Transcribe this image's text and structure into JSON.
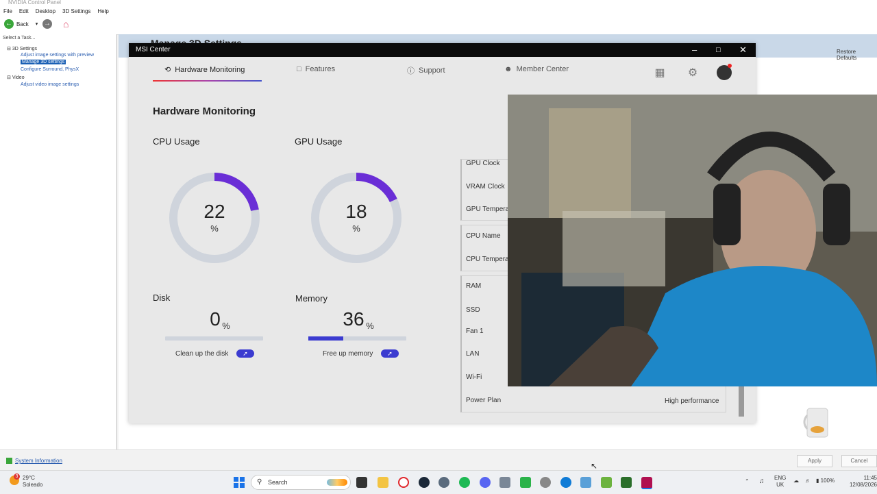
{
  "nvidia": {
    "title": "NVIDIA Control Panel",
    "menu": [
      "File",
      "Edit",
      "Desktop",
      "3D Settings",
      "Help"
    ],
    "back_label": "Back",
    "select_task": "Select a Task...",
    "tree": {
      "group_3d": "3D Settings",
      "adjust_preview": "Adjust image settings with preview",
      "manage_3d": "Manage 3D settings",
      "surround": "Configure Surround, PhysX",
      "group_video": "Video",
      "adjust_video": "Adjust video image settings"
    },
    "page_title": "Manage 3D Settings",
    "restore_defaults": "Restore Defaults",
    "system_information": "System Information",
    "apply": "Apply",
    "cancel": "Cancel"
  },
  "msi": {
    "window_title": "MSI Center",
    "nav": {
      "hardware_monitoring": "Hardware Monitoring",
      "features": "Features",
      "support": "Support",
      "member_center": "Member Center"
    },
    "section_title": "Hardware Monitoring",
    "cpu": {
      "label": "CPU Usage",
      "value": "22",
      "unit": "%",
      "fraction": 0.22
    },
    "gpu": {
      "label": "GPU Usage",
      "value": "18",
      "unit": "%",
      "fraction": 0.18
    },
    "disk": {
      "label": "Disk",
      "value": "0",
      "unit": "%",
      "fraction": 0.0,
      "action": "Clean up the disk"
    },
    "memory": {
      "label": "Memory",
      "value": "36",
      "unit": "%",
      "fraction": 0.36,
      "action": "Free up memory"
    },
    "info_rows": {
      "gpu_clock": "GPU Clock",
      "vram_clock": "VRAM Clock",
      "gpu_temp": "GPU Tempera",
      "cpu_name": "CPU Name",
      "cpu_temp": "CPU Tempera",
      "ram": "RAM",
      "ssd": "SSD",
      "fan1": "Fan 1",
      "lan": "LAN",
      "wifi": "Wi-Fi",
      "power_plan": "Power Plan",
      "power_plan_value": "High performance"
    },
    "colors": {
      "accent": "#3b3bd0",
      "gauge_arc": "#6a2ed6",
      "gauge_track": "#cfd4dc"
    }
  },
  "taskbar": {
    "weather_temp": "29°C",
    "weather_desc": "Soleado",
    "search_placeholder": "Search",
    "lang_top": "ENG",
    "lang_bottom": "UK",
    "battery": "100%",
    "time": "11:45",
    "date": "12/08/2026",
    "badge": "3"
  }
}
